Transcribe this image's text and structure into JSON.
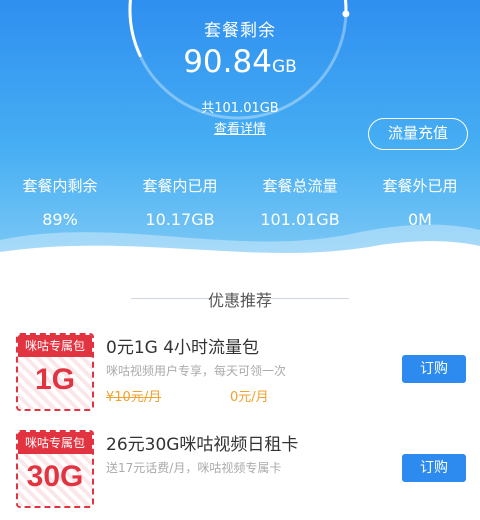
{
  "gauge": {
    "title": "套餐剩余",
    "remaining_value": "90.84",
    "remaining_unit": "GB",
    "remaining_fraction": 0.9,
    "total": "共101.01GB",
    "detail_link": "查看详情"
  },
  "recharge_button": "流量充值",
  "stats": [
    {
      "label": "套餐内剩余",
      "value": "89%"
    },
    {
      "label": "套餐内已用",
      "value": "10.17GB"
    },
    {
      "label": "套餐总流量",
      "value": "101.01GB"
    },
    {
      "label": "套餐外已用",
      "value": "0M"
    }
  ],
  "section_title": "优惠推荐",
  "offers": [
    {
      "badge_label": "咪咕专属包",
      "badge_amount": "1G",
      "title": "0元1G 4小时流量包",
      "desc": "咪咕视频用户专享，每天可领一次",
      "old_price": "¥10元/月",
      "new_price": "0元/月",
      "button": "订购"
    },
    {
      "badge_label": "咪咕专属包",
      "badge_amount": "30G",
      "title": "26元30G咪咕视频日租卡",
      "desc": "送17元话费/月，咪咕视频专属卡",
      "button": "订购"
    }
  ],
  "colors": {
    "header_blue": "#2f8ff0",
    "accent_red": "#e23440",
    "price_orange": "#f0a22d",
    "button_blue": "#2d8bf0"
  }
}
